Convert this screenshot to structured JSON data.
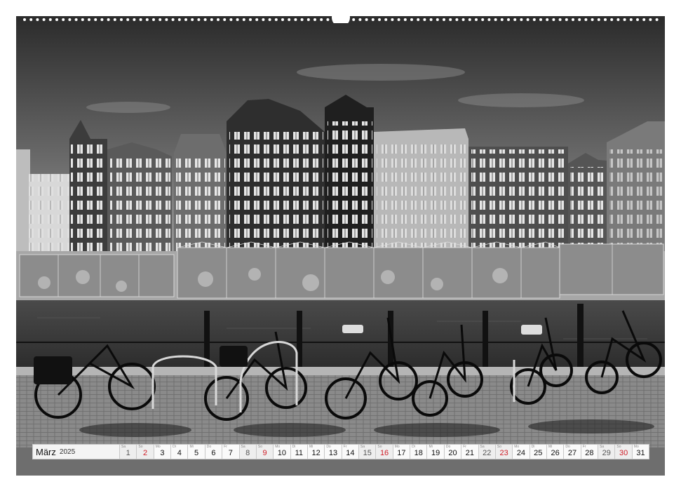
{
  "photo": {
    "description_icon": "amsterdam-canal-bicycles-photo"
  },
  "calendar": {
    "month": "März",
    "year": "2025",
    "accent_color": "#d0202a",
    "days": [
      {
        "num": "1",
        "wd": "Sa",
        "type": "sat"
      },
      {
        "num": "2",
        "wd": "So",
        "type": "sun"
      },
      {
        "num": "3",
        "wd": "Mo",
        "type": "day"
      },
      {
        "num": "4",
        "wd": "Di",
        "type": "day"
      },
      {
        "num": "5",
        "wd": "Mi",
        "type": "day"
      },
      {
        "num": "6",
        "wd": "Do",
        "type": "day"
      },
      {
        "num": "7",
        "wd": "Fr",
        "type": "day"
      },
      {
        "num": "8",
        "wd": "Sa",
        "type": "sat"
      },
      {
        "num": "9",
        "wd": "So",
        "type": "sun"
      },
      {
        "num": "10",
        "wd": "Mo",
        "type": "day"
      },
      {
        "num": "11",
        "wd": "Di",
        "type": "day"
      },
      {
        "num": "12",
        "wd": "Mi",
        "type": "day"
      },
      {
        "num": "13",
        "wd": "Do",
        "type": "day"
      },
      {
        "num": "14",
        "wd": "Fr",
        "type": "day"
      },
      {
        "num": "15",
        "wd": "Sa",
        "type": "sat"
      },
      {
        "num": "16",
        "wd": "So",
        "type": "sun"
      },
      {
        "num": "17",
        "wd": "Mo",
        "type": "day"
      },
      {
        "num": "18",
        "wd": "Di",
        "type": "day"
      },
      {
        "num": "19",
        "wd": "Mi",
        "type": "day"
      },
      {
        "num": "20",
        "wd": "Do",
        "type": "day"
      },
      {
        "num": "21",
        "wd": "Fr",
        "type": "day"
      },
      {
        "num": "22",
        "wd": "Sa",
        "type": "sat"
      },
      {
        "num": "23",
        "wd": "So",
        "type": "sun"
      },
      {
        "num": "24",
        "wd": "Mo",
        "type": "day"
      },
      {
        "num": "25",
        "wd": "Di",
        "type": "day"
      },
      {
        "num": "26",
        "wd": "Mi",
        "type": "day"
      },
      {
        "num": "27",
        "wd": "Do",
        "type": "day"
      },
      {
        "num": "28",
        "wd": "Fr",
        "type": "day"
      },
      {
        "num": "29",
        "wd": "Sa",
        "type": "sat"
      },
      {
        "num": "30",
        "wd": "So",
        "type": "sun"
      },
      {
        "num": "31",
        "wd": "Mo",
        "type": "day"
      }
    ]
  }
}
